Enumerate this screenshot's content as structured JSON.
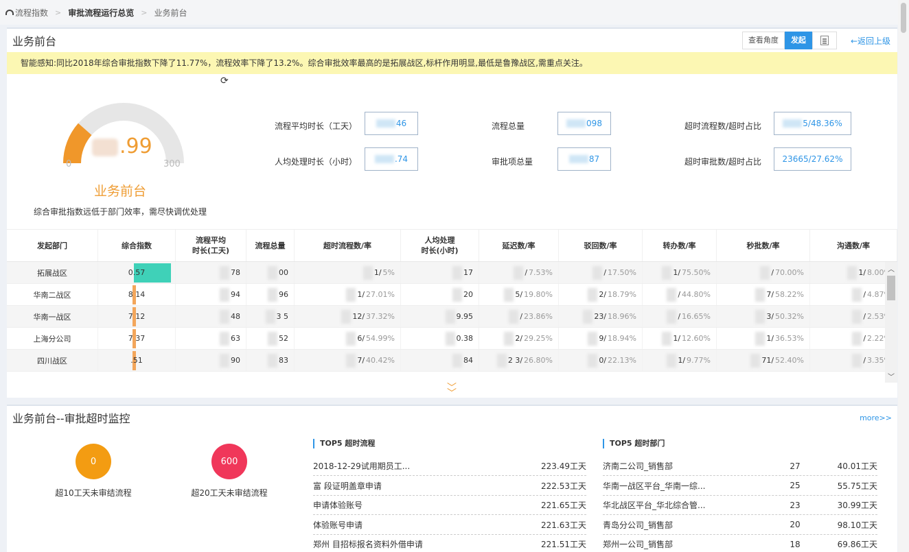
{
  "breadcrumb": {
    "items": [
      "流程指数",
      "审批流程运行总览",
      "业务前台"
    ]
  },
  "panel": {
    "title": "业务前台",
    "tools": {
      "view": "查看角度",
      "initiate": "发起",
      "back": "←返回上级"
    },
    "notice": "智能感知:同比2018年综合审批指数下降了11.77%，流程效率下降了13.2%。综合审批效率最高的是拓展战区,标杆作用明显,最低是鲁豫战区,需重点关注。"
  },
  "gauge": {
    "value_visible": ".99",
    "min": "0",
    "max": "300",
    "fill_fraction": 0.23,
    "name": "业务前台",
    "desc": "综合审批指数远低于部门效率，需尽快调优处理"
  },
  "kpis": [
    {
      "label": "流程平均时长（工天）",
      "value": "46"
    },
    {
      "label": "流程总量",
      "value": "098"
    },
    {
      "label": "超时流程数/超时占比",
      "value": "5/48.36%"
    },
    {
      "label": "人均处理时长（小时）",
      "value": ".74"
    },
    {
      "label": "审批项总量",
      "value": "87"
    },
    {
      "label": "超时审批数/超时占比",
      "value": "23665/27.62%"
    }
  ],
  "table": {
    "headers": [
      "发起部门",
      "综合指数",
      "流程平均\n时长(工天)",
      "流程总量",
      "超时流程数/率",
      "人均处理\n时长(小时)",
      "延迟数/率",
      "驳回数/率",
      "转办数/率",
      "秒批数/率",
      "沟通数/率"
    ],
    "rows": [
      {
        "dept": "拓展战区",
        "index": "0.57",
        "bar": 1.0,
        "avg": "78",
        "total": "00",
        "timeout": [
          "1",
          "5%"
        ],
        "handle": "17",
        "delay": [
          "",
          "7.53%"
        ],
        "reject": [
          "",
          "17.50%"
        ],
        "transfer": [
          "1",
          "75.50%"
        ],
        "instant": [
          "",
          "70.00%"
        ],
        "comm": [
          "1",
          "8.00%"
        ]
      },
      {
        "dept": "华南二战区",
        "index": "8 14",
        "bar": 0.08,
        "avg": "94",
        "total": "96",
        "timeout": [
          "1",
          "27.01%"
        ],
        "handle": "20",
        "delay": [
          "5",
          "19.80%"
        ],
        "reject": [
          "2",
          "18.79%"
        ],
        "transfer": [
          "",
          "44.80%"
        ],
        "instant": [
          "7",
          "58.22%"
        ],
        "comm": [
          "",
          "4.87%"
        ]
      },
      {
        "dept": "华南一战区",
        "index": "7 12",
        "bar": 0.07,
        "avg": "48",
        "total": "3 5",
        "timeout": [
          "12",
          "37.32%"
        ],
        "handle": "9.95",
        "delay": [
          "",
          "23.86%"
        ],
        "reject": [
          "23",
          "18.96%"
        ],
        "transfer": [
          "",
          "16.65%"
        ],
        "instant": [
          "3",
          "50.32%"
        ],
        "comm": [
          "",
          "2.53%"
        ]
      },
      {
        "dept": "上海分公司",
        "index": "7 37",
        "bar": 0.07,
        "avg": "63",
        "total": "52",
        "timeout": [
          "6",
          "54.99%"
        ],
        "handle": "0.38",
        "delay": [
          "2",
          "29.25%"
        ],
        "reject": [
          "9",
          "18.94%"
        ],
        "transfer": [
          "1",
          "12.60%"
        ],
        "instant": [
          "1",
          "36.53%"
        ],
        "comm": [
          "",
          "2.22%"
        ]
      },
      {
        "dept": "四川战区",
        "index": ".51",
        "bar": 0.07,
        "avg": "90",
        "total": "83",
        "timeout": [
          "7",
          "40.42%"
        ],
        "handle": "84",
        "delay": [
          "2 3",
          "26.80%"
        ],
        "reject": [
          "0",
          "22.13%"
        ],
        "transfer": [
          "1",
          "9.77%"
        ],
        "instant": [
          "71",
          "52.40%"
        ],
        "comm": [
          "",
          "3.35%"
        ]
      }
    ]
  },
  "monitor": {
    "title": "业务前台--审批超时监控",
    "more": "more>>",
    "circles": [
      {
        "value": "0",
        "label": "超10工天未审结流程",
        "color": "#f39c12"
      },
      {
        "value": "600",
        "label": "超20工天未审结流程",
        "color": "#f0375a"
      }
    ],
    "top_flows_title": "TOP5 超时流程",
    "top_flows": [
      {
        "name": "2018-12-29试用期员工...",
        "val": "223.49工天"
      },
      {
        "name": "富      段证明盖章申请",
        "val": "222.53工天"
      },
      {
        "name": "        申请体验账号",
        "val": "221.65工天"
      },
      {
        "name": "            体验账号申请",
        "val": "221.63工天"
      },
      {
        "name": "郑州     目招标报名资料外借申请",
        "val": "221.51工天"
      }
    ],
    "top_depts_title": "TOP5 超时部门",
    "top_depts": [
      {
        "name": "济南二公司_销售部",
        "cnt": "27",
        "val": "40.01工天"
      },
      {
        "name": "华南一战区平台_华南一综...",
        "cnt": "25",
        "val": "55.75工天"
      },
      {
        "name": "华北战区平台_华北综合管...",
        "cnt": "23",
        "val": "30.99工天"
      },
      {
        "name": "青岛分公司_销售部",
        "cnt": "20",
        "val": "98.10工天"
      },
      {
        "name": "郑州一公司_销售部",
        "cnt": "18",
        "val": "69.86工天"
      }
    ]
  }
}
